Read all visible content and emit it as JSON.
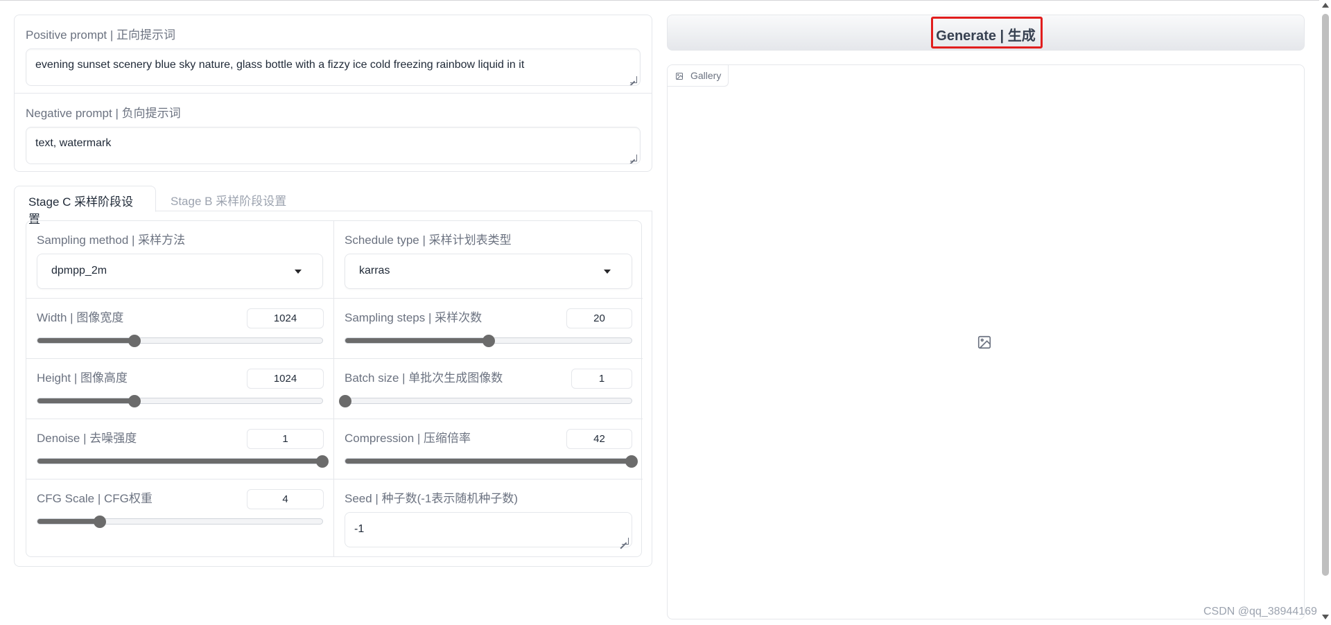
{
  "prompts": {
    "positive_label": "Positive prompt | 正向提示词",
    "positive_value": "evening sunset scenery blue sky nature, glass bottle with a fizzy ice cold freezing rainbow liquid in it",
    "negative_label": "Negative prompt | 负向提示词",
    "negative_value": "text, watermark"
  },
  "tabs": [
    {
      "label": "Stage C 采样阶段设置",
      "active": true
    },
    {
      "label": "Stage B 采样阶段设置",
      "active": false
    }
  ],
  "settings": {
    "sampling_method": {
      "label": "Sampling method | 采样方法",
      "value": "dpmpp_2m"
    },
    "schedule_type": {
      "label": "Schedule type | 采样计划表类型",
      "value": "karras"
    },
    "width": {
      "label": "Width | 图像宽度",
      "value": "1024",
      "fraction": 0.34
    },
    "sampling_steps": {
      "label": "Sampling steps | 采样次数",
      "value": "20",
      "fraction": 0.5
    },
    "height": {
      "label": "Height | 图像高度",
      "value": "1024",
      "fraction": 0.34
    },
    "batch_size": {
      "label": "Batch size | 单批次生成图像数",
      "value": "1",
      "fraction": 0.0
    },
    "denoise": {
      "label": "Denoise | 去噪强度",
      "value": "1",
      "fraction": 1.0
    },
    "compression": {
      "label": "Compression | 压缩倍率",
      "value": "42",
      "fraction": 1.0
    },
    "cfg_scale": {
      "label": "CFG Scale | CFG权重",
      "value": "4",
      "fraction": 0.22
    },
    "seed": {
      "label": "Seed | 种子数(-1表示随机种子数)",
      "value": "-1"
    }
  },
  "generate": {
    "label": "Generate | 生成"
  },
  "gallery": {
    "label": "Gallery"
  },
  "watermark": "CSDN @qq_38944169",
  "colors": {
    "highlight": "#e11d1d",
    "slider": "#6b6b6b"
  }
}
